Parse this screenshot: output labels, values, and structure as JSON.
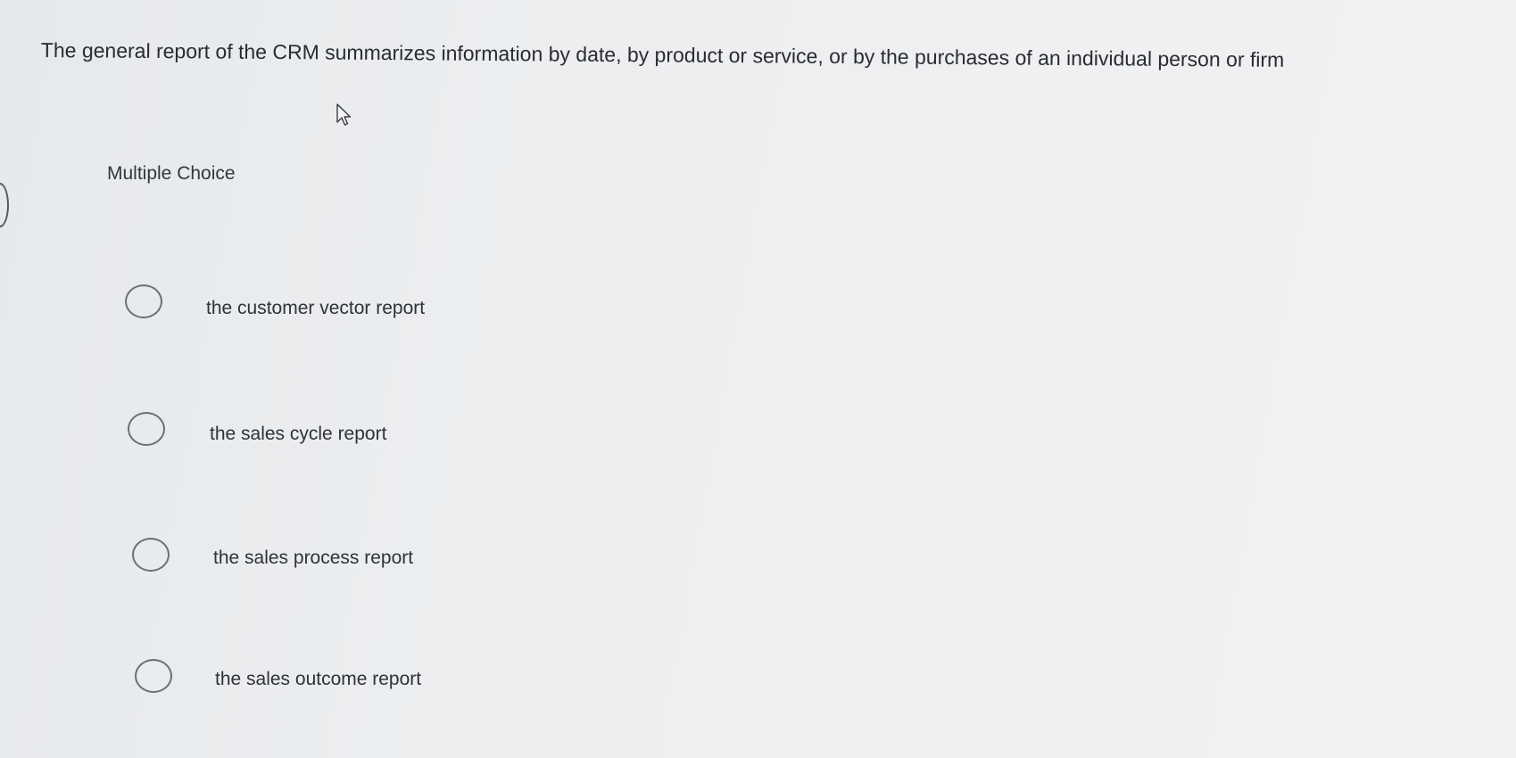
{
  "question": {
    "text": "The general report of the CRM summarizes information by date, by product or service, or by the purchases of an individual person or firm"
  },
  "question_type": "Multiple Choice",
  "options": [
    {
      "label": "the customer vector report",
      "selected": false
    },
    {
      "label": "the sales cycle report",
      "selected": false
    },
    {
      "label": "the sales process report",
      "selected": false
    },
    {
      "label": "the sales outcome report",
      "selected": false
    }
  ],
  "icons": {
    "cursor": "mouse-pointer-icon",
    "radio": "radio-button-icon"
  },
  "colors": {
    "background": "#eceef0",
    "text": "#2b2d30",
    "radio_border": "#6b6e72"
  }
}
